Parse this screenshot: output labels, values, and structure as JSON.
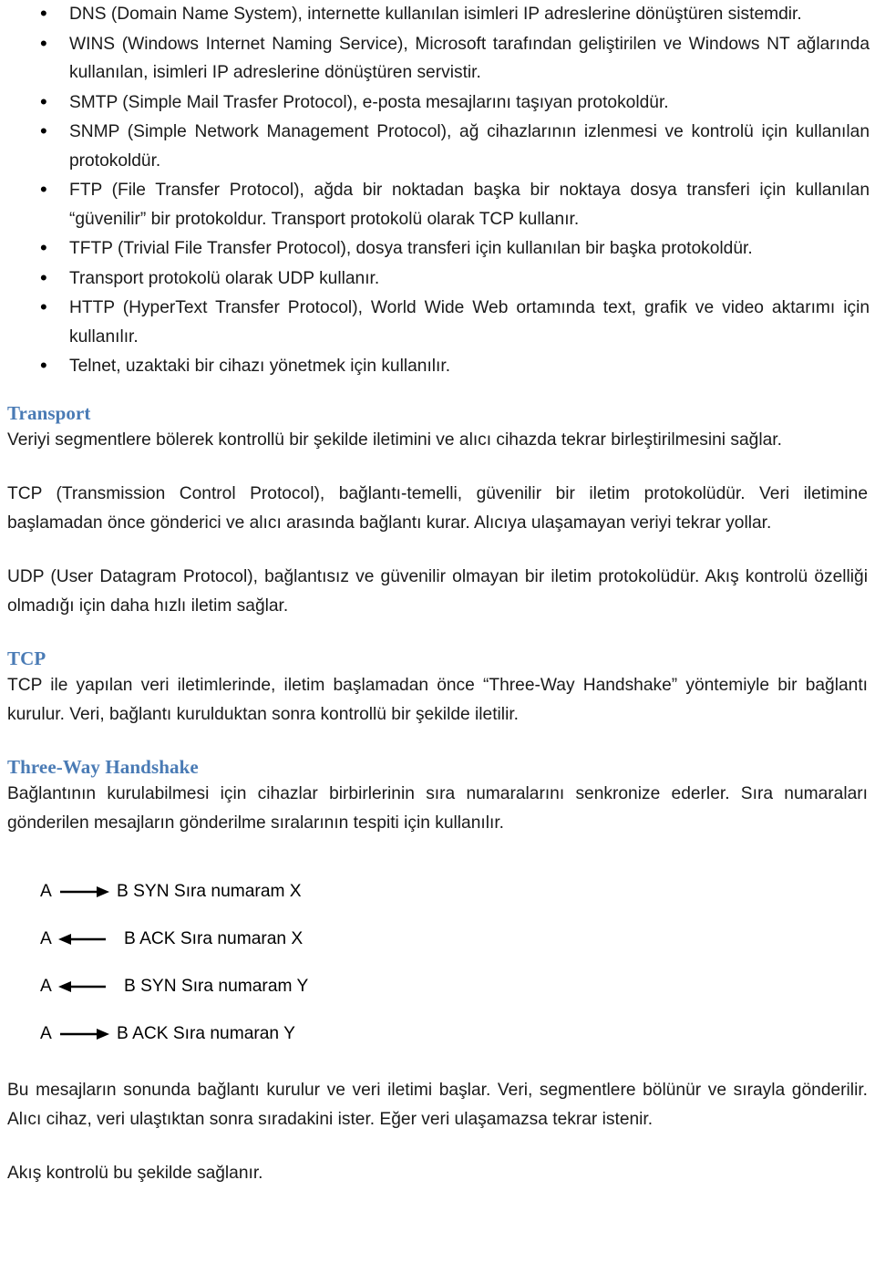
{
  "document": {
    "background_color": "#ffffff",
    "body_text_color": "#1a1a1a",
    "heading_color": "#4A7BB5"
  },
  "protocol_bullets": [
    "DNS (Domain Name System), internette kullanılan isimleri IP adreslerine dönüştüren sistemdir.",
    "WINS (Windows Internet Naming Service), Microsoft tarafından geliştirilen ve Windows NT ağlarında kullanılan, isimleri IP adreslerine dönüştüren servistir.",
    "SMTP (Simple Mail Trasfer Protocol), e-posta mesajlarını taşıyan protokoldür.",
    "SNMP (Simple Network Management Protocol), ağ cihazlarının izlenmesi ve kontrolü için kullanılan protokoldür.",
    "FTP (File Transfer Protocol), ağda bir noktadan başka bir noktaya dosya transferi için kullanılan “güvenilir” bir protokoldur. Transport protokolü olarak TCP kullanır.",
    "TFTP (Trivial File Transfer Protocol), dosya transferi için kullanılan bir başka protokoldür.",
    "Transport protokolü olarak UDP kullanır.",
    "HTTP (HyperText Transfer Protocol), World Wide Web ortamında text, grafik ve video aktarımı için kullanılır.",
    "Telnet, uzaktaki bir cihazı yönetmek için kullanılır."
  ],
  "transport_section": {
    "heading": "Transport",
    "intro_paragraph": "Veriyi segmentlere bölerek kontrollü bir şekilde iletimini ve alıcı cihazda tekrar birleştirilmesini sağlar.",
    "tcp_paragraph": "TCP (Transmission Control Protocol), bağlantı-temelli, güvenilir bir iletim protokolüdür. Veri iletimine başlamadan önce gönderici ve alıcı arasında bağlantı kurar. Alıcıya ulaşamayan veriyi tekrar yollar.",
    "udp_paragraph": "UDP (User Datagram Protocol), bağlantısız ve güvenilir olmayan bir iletim protokolüdür. Akış kontrolü özelliği olmadığı için daha hızlı iletim sağlar."
  },
  "tcp_section": {
    "heading": "TCP",
    "paragraph": "TCP ile yapılan veri iletimlerinde, iletim başlamadan önce “Three-Way Handshake” yöntemiyle bir bağlantı kurulur. Veri, bağlantı kurulduktan sonra kontrollü bir şekilde iletilir."
  },
  "handshake_section": {
    "heading": "Three-Way Handshake",
    "intro_paragraph": "Bağlantının kurulabilmesi için cihazlar birbirlerinin sıra numaralarını senkronize ederler. Sıra numaraları gönderilen mesajların gönderilme sıralarının tespiti için kullanılır.",
    "steps": [
      {
        "from": "A",
        "direction": "right",
        "label": "B SYN Sıra numaram X"
      },
      {
        "from": "A",
        "direction": "left",
        "label": "B ACK Sıra numaran X"
      },
      {
        "from": "A",
        "direction": "left",
        "label": "B SYN Sıra numaram Y"
      },
      {
        "from": "A",
        "direction": "right",
        "label": "B ACK Sıra numaran Y"
      }
    ],
    "closing_paragraph": "Bu mesajların sonunda bağlantı kurulur ve veri iletimi başlar. Veri, segmentlere bölünür ve sırayla gönderilir. Alıcı cihaz, veri ulaştıktan sonra sıradakini ister. Eğer veri ulaşamazsa tekrar istenir.",
    "flow_control_note": "Akış kontrolü bu şekilde sağlanır."
  }
}
